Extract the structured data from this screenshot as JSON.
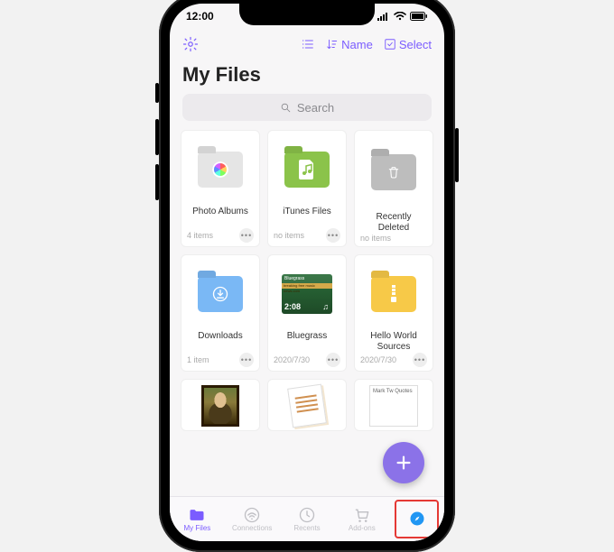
{
  "status": {
    "time": "12:00"
  },
  "topnav": {
    "sort_label": "Name",
    "select_label": "Select"
  },
  "page": {
    "title": "My Files"
  },
  "search": {
    "placeholder": "Search"
  },
  "files": [
    {
      "name": "Photo Albums",
      "meta": "4 items"
    },
    {
      "name": "iTunes Files",
      "meta": "no items"
    },
    {
      "name": "Recently Deleted",
      "meta": "no items"
    },
    {
      "name": "Downloads",
      "meta": "1 item"
    },
    {
      "name": "Bluegrass",
      "meta": "2020/7/30",
      "duration": "2:08"
    },
    {
      "name": "Hello World Sources",
      "meta": "2020/7/30"
    }
  ],
  "partial_tile_text": "Mark Tw\nQuotes",
  "tabs": [
    {
      "label": "My Files"
    },
    {
      "label": "Connections"
    },
    {
      "label": "Recents"
    },
    {
      "label": "Add-ons"
    },
    {
      "label": ""
    }
  ],
  "colors": {
    "accent": "#7b5cff"
  }
}
